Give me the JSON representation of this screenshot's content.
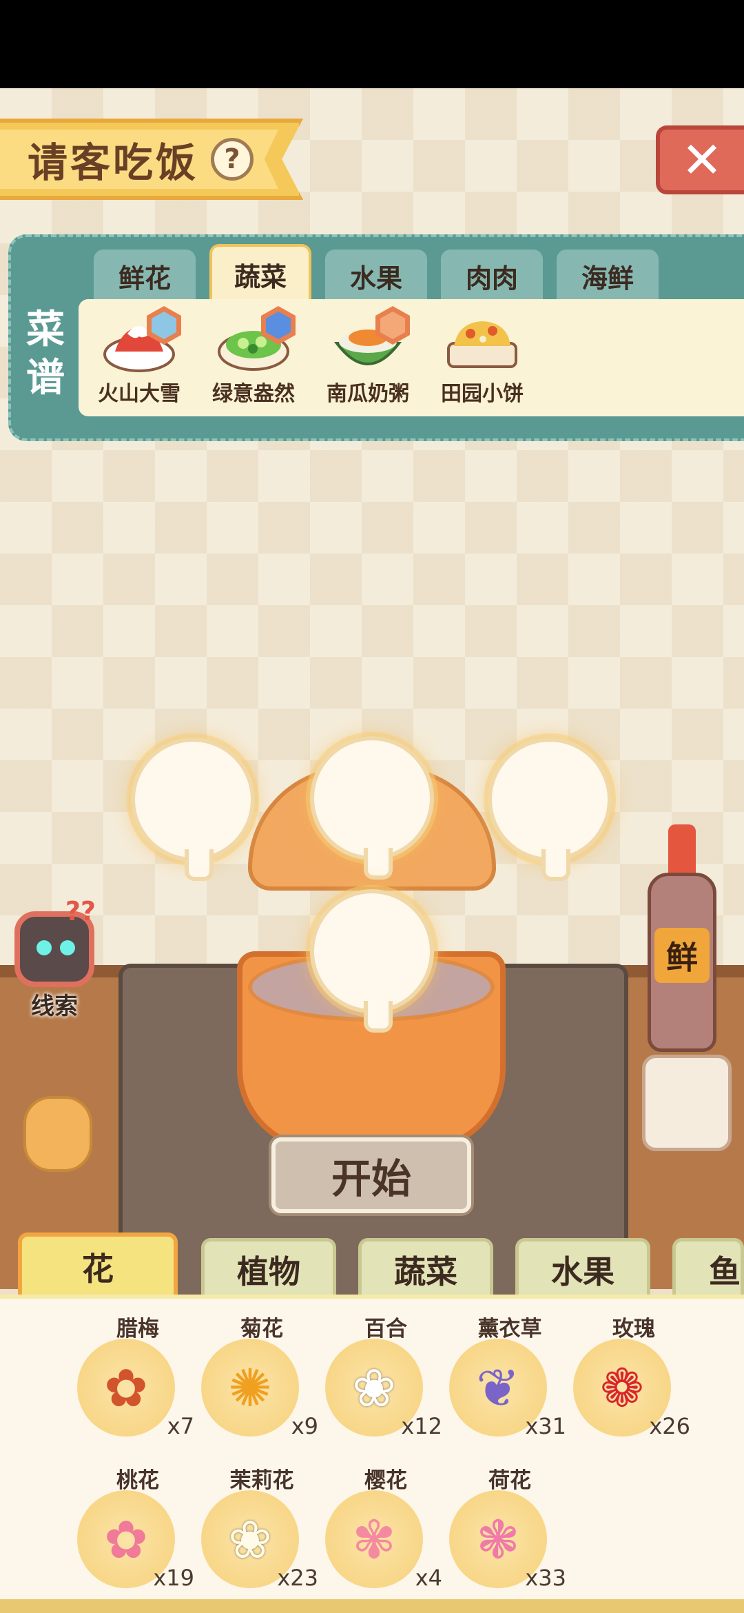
{
  "header": {
    "title": "请客吃饭",
    "help_label": "?",
    "close_label": "✕"
  },
  "recipe_panel": {
    "side_label_1": "菜",
    "side_label_2": "谱",
    "tabs": [
      {
        "label": "鲜花",
        "active": false
      },
      {
        "label": "蔬菜",
        "active": true
      },
      {
        "label": "水果",
        "active": false
      },
      {
        "label": "肉肉",
        "active": false
      },
      {
        "label": "海鲜",
        "active": false
      }
    ],
    "dishes": [
      {
        "name": "火山大雪",
        "icon": "volcano-snow-dish-icon",
        "badge": true
      },
      {
        "name": "绿意盎然",
        "icon": "green-salad-dish-icon",
        "badge": true
      },
      {
        "name": "南瓜奶粥",
        "icon": "pumpkin-porridge-dish-icon",
        "badge": true
      },
      {
        "name": "田园小饼",
        "icon": "garden-pancake-dish-icon",
        "badge": false
      }
    ]
  },
  "cooking": {
    "start_label": "开始",
    "clue_label": "线索",
    "clue_mark": "??",
    "bottle_label": "鲜"
  },
  "ingredient_tabs": [
    {
      "label": "花",
      "active": true
    },
    {
      "label": "植物",
      "active": false
    },
    {
      "label": "蔬菜",
      "active": false
    },
    {
      "label": "水果",
      "active": false
    },
    {
      "label": "鱼",
      "active": false
    }
  ],
  "ingredients": [
    {
      "name": "腊梅",
      "count": "x7",
      "glyph": "✿",
      "color": "#d2542c"
    },
    {
      "name": "菊花",
      "count": "x9",
      "glyph": "✺",
      "color": "#f0a020"
    },
    {
      "name": "百合",
      "count": "x12",
      "glyph": "❀",
      "color": "#ffffff"
    },
    {
      "name": "薰衣草",
      "count": "x31",
      "glyph": "❦",
      "color": "#7a64c8"
    },
    {
      "name": "玫瑰",
      "count": "x26",
      "glyph": "❁",
      "color": "#d8262c"
    },
    {
      "name": "桃花",
      "count": "x19",
      "glyph": "✿",
      "color": "#f07a98"
    },
    {
      "name": "茉莉花",
      "count": "x23",
      "glyph": "❀",
      "color": "#fffbe8"
    },
    {
      "name": "樱花",
      "count": "x4",
      "glyph": "✾",
      "color": "#f48aa0"
    },
    {
      "name": "荷花",
      "count": "x33",
      "glyph": "❃",
      "color": "#f07aa8"
    }
  ]
}
